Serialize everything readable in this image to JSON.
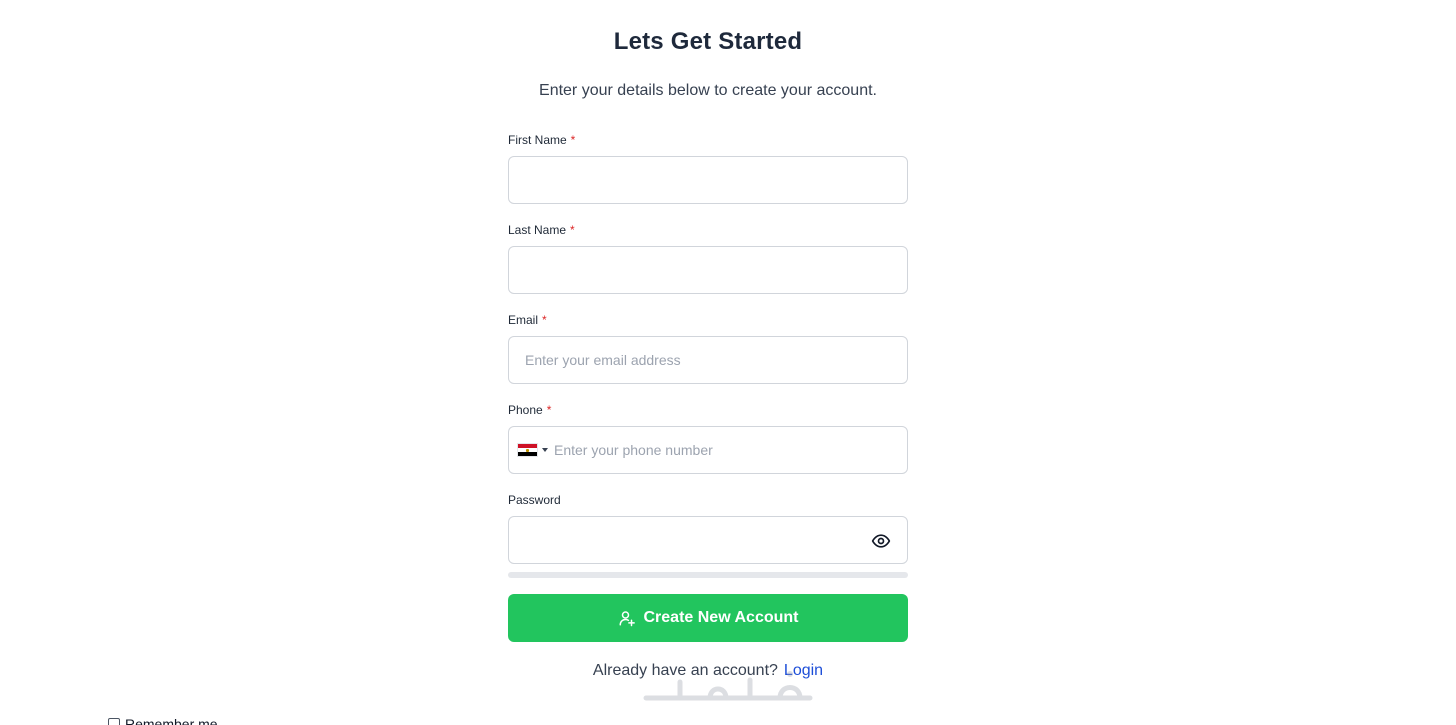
{
  "header": {
    "title": "Lets Get Started",
    "subtitle": "Enter your details below to create your account."
  },
  "form": {
    "first_name": {
      "label": "First Name",
      "required_mark": "*",
      "value": "",
      "placeholder": ""
    },
    "last_name": {
      "label": "Last Name",
      "required_mark": "*",
      "value": "",
      "placeholder": ""
    },
    "email": {
      "label": "Email",
      "required_mark": "*",
      "value": "",
      "placeholder": "Enter your email address"
    },
    "phone": {
      "label": "Phone",
      "required_mark": "*",
      "value": "",
      "placeholder": "Enter your phone number",
      "country_flag": "egypt-flag-icon"
    },
    "password": {
      "label": "Password",
      "value": "",
      "toggle_icon": "eye-icon",
      "strength_fraction": 0
    },
    "submit": {
      "label": "Create New Account",
      "icon": "user-plus-icon"
    }
  },
  "login": {
    "prompt": "Already have an account?",
    "link_label": "Login"
  },
  "remember_me": {
    "label": "Remember me",
    "checked": false
  },
  "watermark": {
    "text": "خمسات"
  },
  "colors": {
    "primary_button": "#22c55e",
    "link": "#1d4ed8",
    "required": "#dc2626",
    "border": "#d1d5db"
  }
}
